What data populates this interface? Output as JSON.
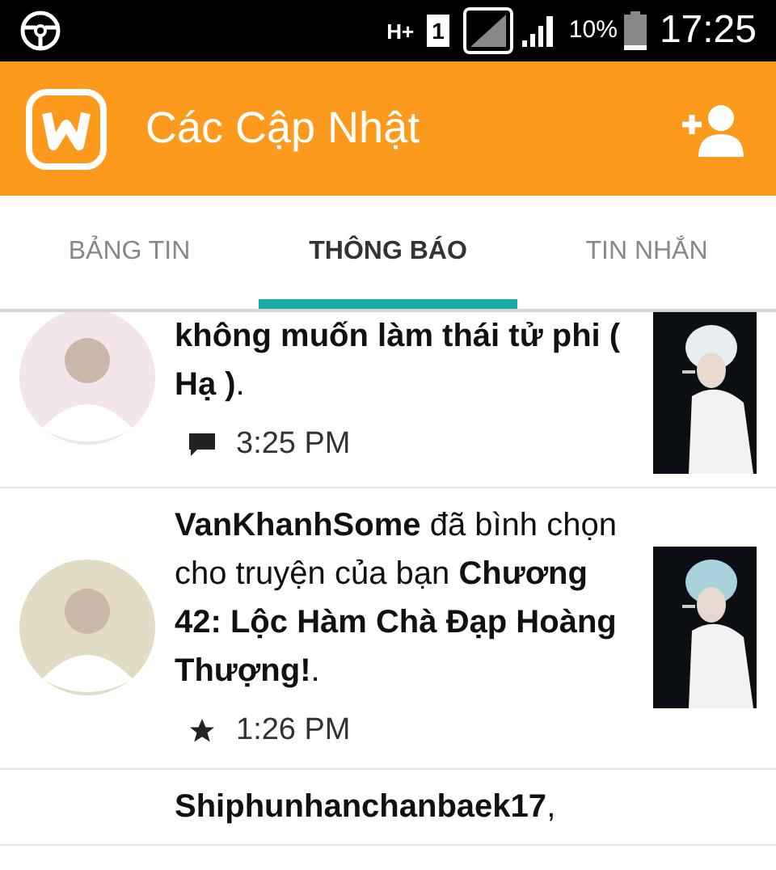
{
  "status_bar": {
    "network": "H+",
    "sim": "1",
    "battery": "10%",
    "time": "17:25"
  },
  "app_bar": {
    "title": "Các Cập Nhật"
  },
  "tabs": [
    {
      "label": "BẢNG TIN",
      "selected": false
    },
    {
      "label": "THÔNG BÁO",
      "selected": true
    },
    {
      "label": "TIN NHẮN",
      "selected": false
    }
  ],
  "notifications": [
    {
      "text": "**không muốn làm thái tử phi ( Hạ )**.",
      "kind": "comment",
      "time": "3:25 PM"
    },
    {
      "text": "**VanKhanhSome** đã bình chọn cho truyện của bạn **Chương 42: Lộc Hàm Chà Đạp Hoàng Thượng!**.",
      "kind": "vote",
      "time": "1:26 PM"
    },
    {
      "text": "**Shiphunhanchanbaek17**,"
    }
  ]
}
